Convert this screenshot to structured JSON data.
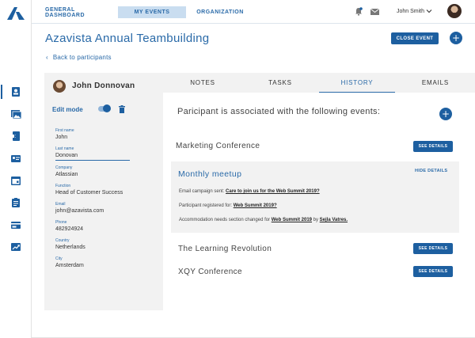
{
  "app": {
    "brand_color": "#1d5fa0",
    "accent_light": "#c9ddf0"
  },
  "rail": {
    "icons": [
      "logo-icon",
      "contacts-icon",
      "photos-icon",
      "document-icon",
      "id-card-icon",
      "calendar-icon",
      "clipboard-icon",
      "credit-card-icon",
      "trending-icon"
    ]
  },
  "topnav": {
    "tabs": [
      {
        "label": "GENERAL DASHBOARD"
      },
      {
        "label": "MY EVENTS"
      },
      {
        "label": "ORGANIZATION"
      }
    ],
    "user_name": "John Smith"
  },
  "header": {
    "title": "Azavista Annual Teambuilding",
    "close_event_label": "CLOSE EVENT",
    "add_label": "+",
    "back_label": "Back to participants",
    "back_arrow": "‹"
  },
  "participant": {
    "name": "John Donnovan",
    "edit_mode_label": "Edit mode",
    "fields": [
      {
        "label": "First name",
        "value": "John"
      },
      {
        "label": "Last name",
        "value": "Donovan"
      },
      {
        "label": "Company",
        "value": "Atlassian"
      },
      {
        "label": "Function",
        "value": "Head of Customer Success"
      },
      {
        "label": "Email",
        "value": "john@azavista.com"
      },
      {
        "label": "Phone",
        "value": "482924924"
      },
      {
        "label": "Country",
        "value": "Netherlands"
      },
      {
        "label": "City",
        "value": "Amsterdam"
      }
    ]
  },
  "tabs": [
    {
      "label": "NOTES"
    },
    {
      "label": "TASKS"
    },
    {
      "label": "HISTORY"
    },
    {
      "label": "EMAILS"
    }
  ],
  "history": {
    "intro": "Paricipant is  associated with the following events:",
    "add_label": "+",
    "see_details_label": "SEE DETAILS",
    "hide_details_label": "HIDE DETAILS",
    "events": [
      {
        "title": "Marketing Conference"
      },
      {
        "title": "Monthly meetup"
      },
      {
        "title": "The Learning Revolution"
      },
      {
        "title": "XQY Conference"
      }
    ],
    "details": [
      {
        "text": "Email campaign sent: ",
        "link": "Care to join us for the Web Summit 2019?"
      },
      {
        "text": "Participant registered for: ",
        "link": "Web Summit 2019?"
      },
      {
        "text": "Accommodation needs section changed for ",
        "link": "Web Summit 2019",
        "by_text": " by ",
        "by_link": "Sejla Vatres."
      }
    ]
  }
}
